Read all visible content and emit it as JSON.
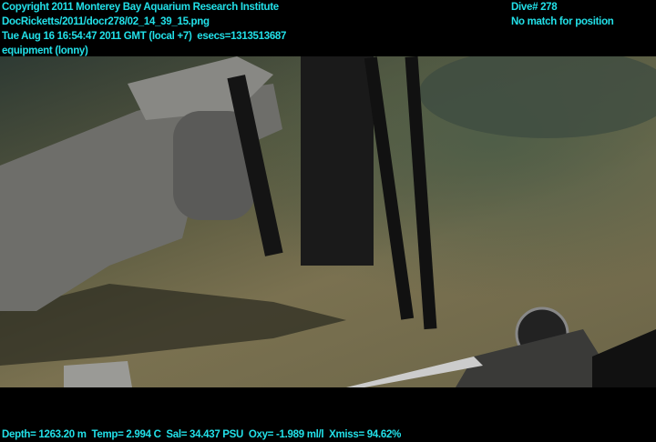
{
  "overlay_top_left": [
    "Copyright 2011 Monterey Bay Aquarium Research Institute",
    "DocRicketts/2011/docr278/02_14_39_15.png",
    "Tue Aug 16 16:54:47 2011 GMT (local +7)  esecs=1313513687",
    "equipment (lonny)"
  ],
  "overlay_top_right": [
    "Dive# 278",
    "No match for position"
  ],
  "overlay_bottom": "Depth= 1263.20 m  Temp= 2.994 C  Sal= 34.437 PSU  Oxy= -1.989 ml/l  Xmiss= 94.62%",
  "colors": {
    "overlay_text": "#22e0e8",
    "background": "#000000"
  }
}
